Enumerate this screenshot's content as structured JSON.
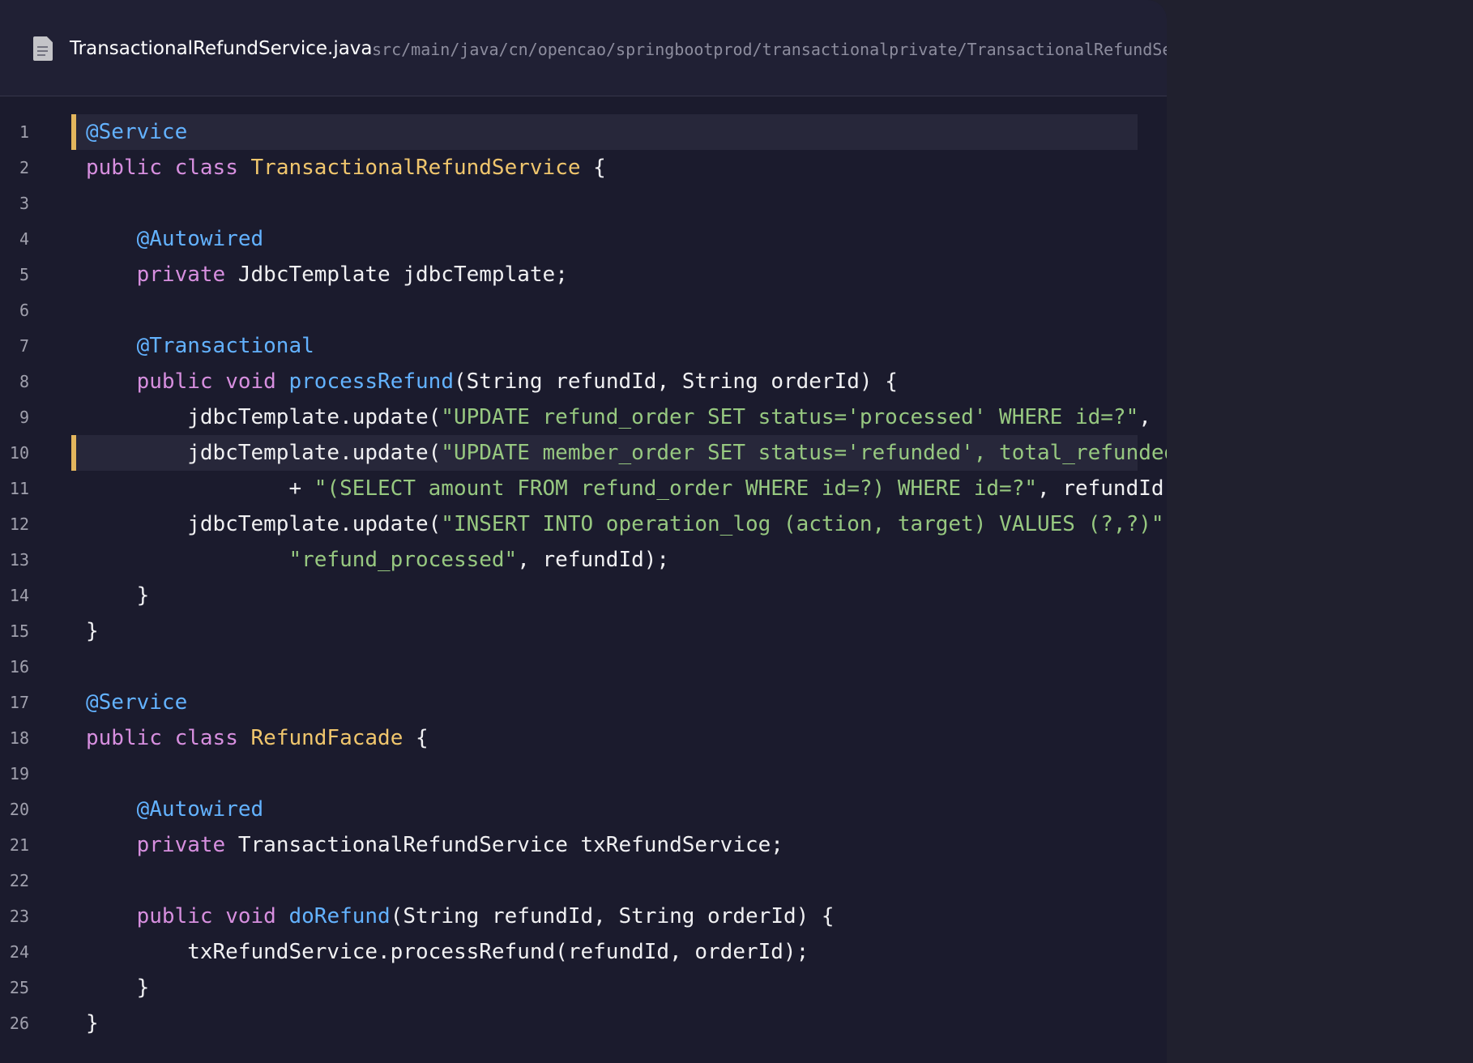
{
  "file": {
    "icon": "document-icon",
    "name": "TransactionalRefundService.java",
    "path": "src/main/java/cn/opencao/springbootprod/transactionalprivate/TransactionalRefundService.java"
  },
  "colors": {
    "background": "#1b1b2d",
    "outer_background": "#20202e",
    "header_background": "#202034",
    "highlight_background": "#27273a",
    "highlight_marker": "#e3b65d",
    "keyword": "#d78fdf",
    "annotation": "#63b2ff",
    "class_name": "#f0c66d",
    "method": "#63b2ff",
    "string": "#97c880",
    "text": "#f0f0f2"
  },
  "code": {
    "lines": [
      {
        "number": "1",
        "highlighted": true,
        "tokens": [
          {
            "text": "@Service",
            "type": "annotation"
          }
        ]
      },
      {
        "number": "2",
        "tokens": [
          {
            "text": "public",
            "type": "keyword"
          },
          {
            "text": " ",
            "type": "plain"
          },
          {
            "text": "class",
            "type": "keyword"
          },
          {
            "text": " ",
            "type": "plain"
          },
          {
            "text": "TransactionalRefundService",
            "type": "class"
          },
          {
            "text": " {",
            "type": "plain"
          }
        ]
      },
      {
        "number": "3",
        "tokens": []
      },
      {
        "number": "4",
        "tokens": [
          {
            "text": "    ",
            "type": "plain"
          },
          {
            "text": "@Autowired",
            "type": "annotation"
          }
        ]
      },
      {
        "number": "5",
        "tokens": [
          {
            "text": "    ",
            "type": "plain"
          },
          {
            "text": "private",
            "type": "keyword"
          },
          {
            "text": " JdbcTemplate jdbcTemplate;",
            "type": "plain"
          }
        ]
      },
      {
        "number": "6",
        "tokens": []
      },
      {
        "number": "7",
        "tokens": [
          {
            "text": "    ",
            "type": "plain"
          },
          {
            "text": "@Transactional",
            "type": "annotation"
          }
        ]
      },
      {
        "number": "8",
        "tokens": [
          {
            "text": "    ",
            "type": "plain"
          },
          {
            "text": "public",
            "type": "keyword"
          },
          {
            "text": " ",
            "type": "plain"
          },
          {
            "text": "void",
            "type": "keyword"
          },
          {
            "text": " ",
            "type": "plain"
          },
          {
            "text": "processRefund",
            "type": "method"
          },
          {
            "text": "(String refundId, String orderId) {",
            "type": "plain"
          }
        ]
      },
      {
        "number": "9",
        "tokens": [
          {
            "text": "        jdbcTemplate.update(",
            "type": "plain"
          },
          {
            "text": "\"UPDATE refund_order SET status='processed' WHERE id=?\"",
            "type": "string"
          },
          {
            "text": ", refundId);",
            "type": "plain"
          }
        ]
      },
      {
        "number": "10",
        "highlighted": true,
        "tokens": [
          {
            "text": "        jdbcTemplate.update(",
            "type": "plain"
          },
          {
            "text": "\"UPDATE member_order SET status='refunded', total_refunded = \"",
            "type": "string"
          }
        ]
      },
      {
        "number": "11",
        "tokens": [
          {
            "text": "                + ",
            "type": "plain"
          },
          {
            "text": "\"(SELECT amount FROM refund_order WHERE id=?) WHERE id=?\"",
            "type": "string"
          },
          {
            "text": ", refundId, orderId);",
            "type": "plain"
          }
        ]
      },
      {
        "number": "12",
        "tokens": [
          {
            "text": "        jdbcTemplate.update(",
            "type": "plain"
          },
          {
            "text": "\"INSERT INTO operation_log (action, target) VALUES (?,?)\"",
            "type": "string"
          },
          {
            "text": ",",
            "type": "plain"
          }
        ]
      },
      {
        "number": "13",
        "tokens": [
          {
            "text": "                ",
            "type": "plain"
          },
          {
            "text": "\"refund_processed\"",
            "type": "string"
          },
          {
            "text": ", refundId);",
            "type": "plain"
          }
        ]
      },
      {
        "number": "14",
        "tokens": [
          {
            "text": "    }",
            "type": "plain"
          }
        ]
      },
      {
        "number": "15",
        "tokens": [
          {
            "text": "}",
            "type": "plain"
          }
        ]
      },
      {
        "number": "16",
        "tokens": []
      },
      {
        "number": "17",
        "tokens": [
          {
            "text": "@Service",
            "type": "annotation"
          }
        ]
      },
      {
        "number": "18",
        "tokens": [
          {
            "text": "public",
            "type": "keyword"
          },
          {
            "text": " ",
            "type": "plain"
          },
          {
            "text": "class",
            "type": "keyword"
          },
          {
            "text": " ",
            "type": "plain"
          },
          {
            "text": "RefundFacade",
            "type": "class"
          },
          {
            "text": " {",
            "type": "plain"
          }
        ]
      },
      {
        "number": "19",
        "tokens": []
      },
      {
        "number": "20",
        "tokens": [
          {
            "text": "    ",
            "type": "plain"
          },
          {
            "text": "@Autowired",
            "type": "annotation"
          }
        ]
      },
      {
        "number": "21",
        "tokens": [
          {
            "text": "    ",
            "type": "plain"
          },
          {
            "text": "private",
            "type": "keyword"
          },
          {
            "text": " TransactionalRefundService txRefundService;",
            "type": "plain"
          }
        ]
      },
      {
        "number": "22",
        "tokens": []
      },
      {
        "number": "23",
        "tokens": [
          {
            "text": "    ",
            "type": "plain"
          },
          {
            "text": "public",
            "type": "keyword"
          },
          {
            "text": " ",
            "type": "plain"
          },
          {
            "text": "void",
            "type": "keyword"
          },
          {
            "text": " ",
            "type": "plain"
          },
          {
            "text": "doRefund",
            "type": "method"
          },
          {
            "text": "(String refundId, String orderId) {",
            "type": "plain"
          }
        ]
      },
      {
        "number": "24",
        "tokens": [
          {
            "text": "        txRefundService.processRefund(refundId, orderId);",
            "type": "plain"
          }
        ]
      },
      {
        "number": "25",
        "tokens": [
          {
            "text": "    }",
            "type": "plain"
          }
        ]
      },
      {
        "number": "26",
        "tokens": [
          {
            "text": "}",
            "type": "plain"
          }
        ]
      }
    ]
  }
}
